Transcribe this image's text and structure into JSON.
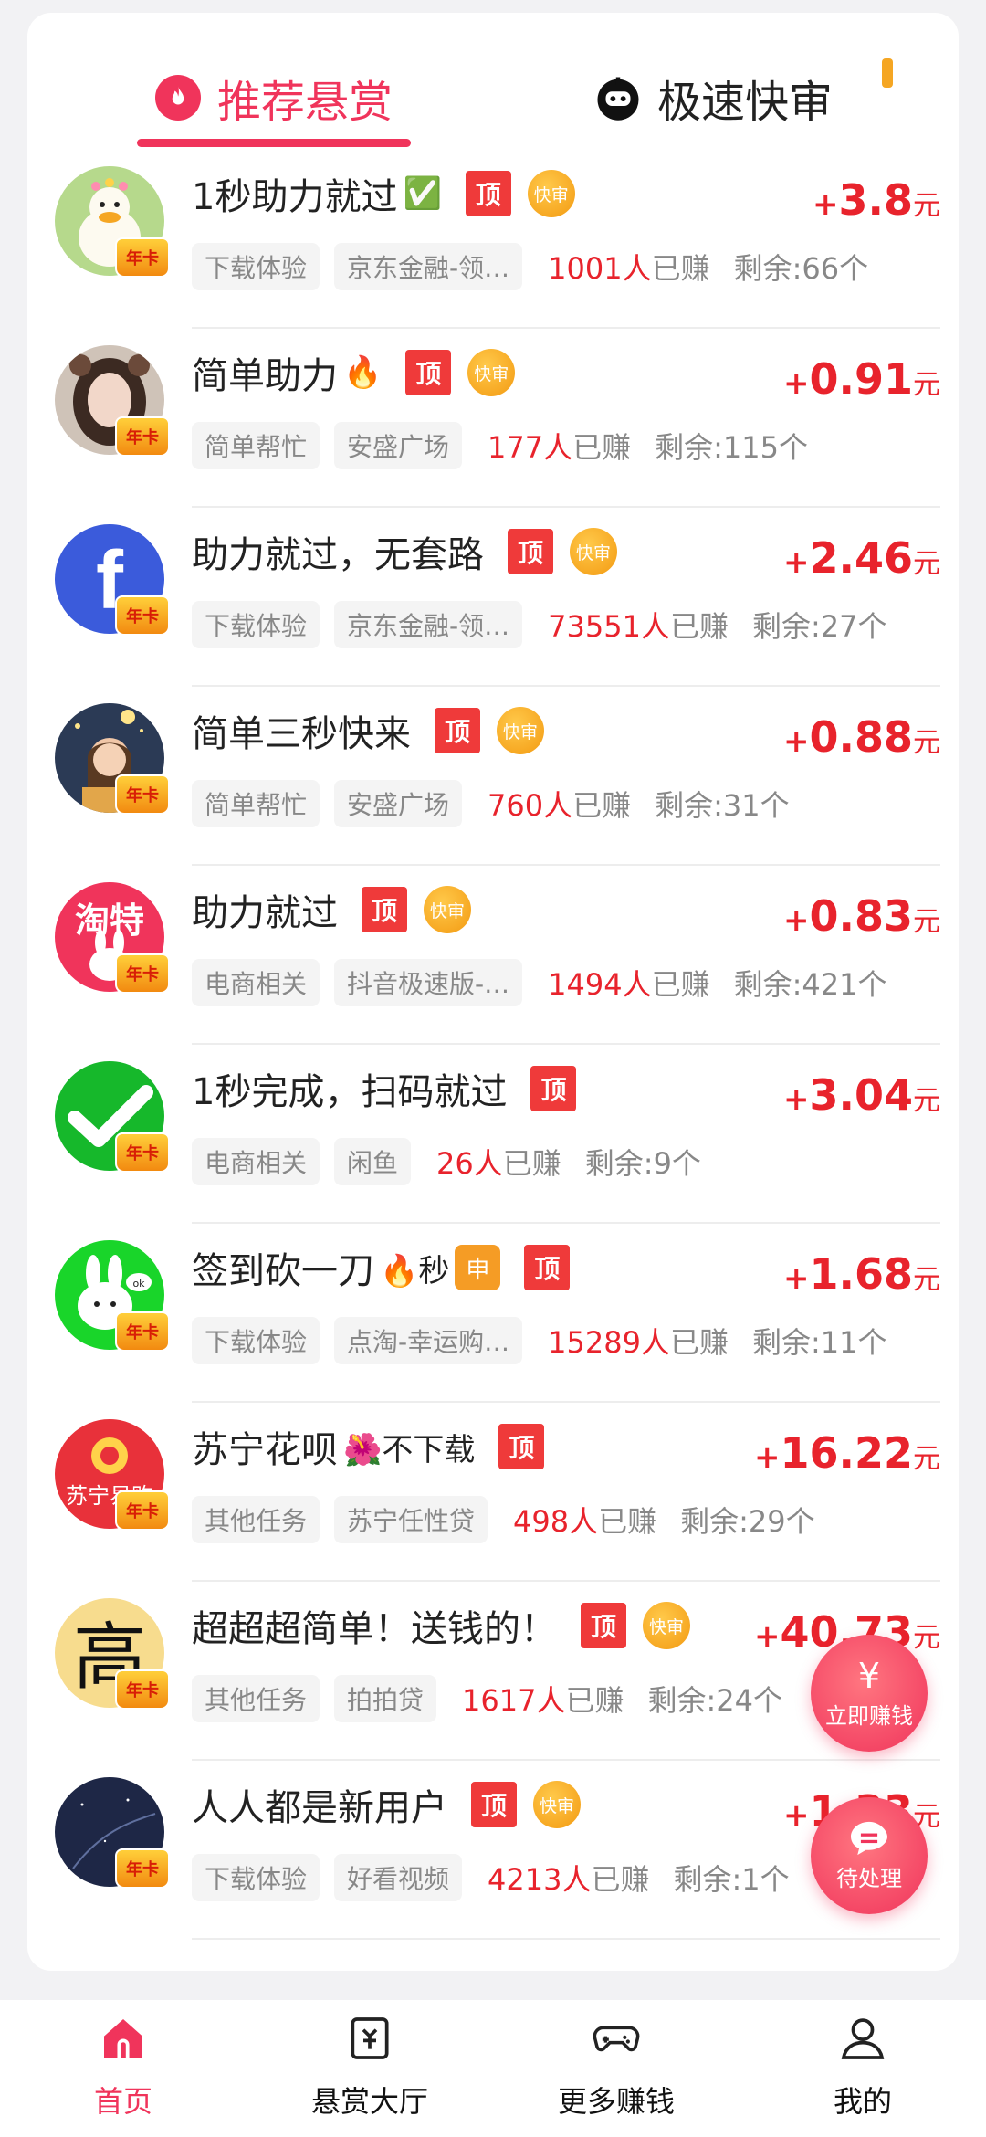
{
  "tabs": {
    "recommended": "推荐悬赏",
    "fast": "极速快审"
  },
  "badges": {
    "ding": "顶",
    "kuai": "快审",
    "year_card": "年卡",
    "shen": "申"
  },
  "tasks": [
    {
      "title": "1秒助力就过",
      "emoji": "✅",
      "ding": true,
      "kuai": true,
      "reward": "3.8",
      "cat": "下载体验",
      "app": "京东金融-领…",
      "earned": "1001人",
      "earned_suffix": "已赚",
      "remain": "剩余:66个",
      "avatar": "duck"
    },
    {
      "title": "简单助力",
      "emoji": "🔥",
      "ding": true,
      "kuai": true,
      "reward": "0.91",
      "cat": "简单帮忙",
      "app": "安盛广场",
      "earned": "177人",
      "earned_suffix": "已赚",
      "remain": "剩余:115个",
      "avatar": "girl"
    },
    {
      "title": "助力就过，无套路",
      "emoji": "",
      "ding": true,
      "kuai": true,
      "reward": "2.46",
      "cat": "下载体验",
      "app": "京东金融-领…",
      "earned": "73551人",
      "earned_suffix": "已赚",
      "remain": "剩余:27个",
      "avatar": "fb"
    },
    {
      "title": "简单三秒快来",
      "emoji": "",
      "ding": true,
      "kuai": true,
      "reward": "0.88",
      "cat": "简单帮忙",
      "app": "安盛广场",
      "earned": "760人",
      "earned_suffix": "已赚",
      "remain": "剩余:31个",
      "avatar": "night"
    },
    {
      "title": "助力就过",
      "emoji": "",
      "ding": true,
      "kuai": true,
      "reward": "0.83",
      "cat": "电商相关",
      "app": "抖音极速版-…",
      "earned": "1494人",
      "earned_suffix": "已赚",
      "remain": "剩余:421个",
      "avatar": "taote"
    },
    {
      "title": "1秒完成，扫码就过",
      "emoji": "",
      "ding": true,
      "kuai": false,
      "reward": "3.04",
      "cat": "电商相关",
      "app": "闲鱼",
      "earned": "26人",
      "earned_suffix": "已赚",
      "remain": "剩余:9个",
      "avatar": "check"
    },
    {
      "title": "签到砍一刀",
      "emoji": "🔥秒",
      "shen": true,
      "ding": true,
      "kuai": false,
      "reward": "1.68",
      "cat": "下载体验",
      "app": "点淘-幸运购…",
      "earned": "15289人",
      "earned_suffix": "已赚",
      "remain": "剩余:11个",
      "avatar": "bunny"
    },
    {
      "title": "苏宁花呗",
      "emoji": "🌺不下载",
      "ding": true,
      "kuai": false,
      "reward": "16.22",
      "cat": "其他任务",
      "app": "苏宁任性贷",
      "earned": "498人",
      "earned_suffix": "已赚",
      "remain": "剩余:29个",
      "avatar": "suning"
    },
    {
      "title": "超超超简单！送钱的！",
      "emoji": "",
      "ding": true,
      "kuai": true,
      "reward": "40.73",
      "cat": "其他任务",
      "app": "拍拍贷",
      "earned": "1617人",
      "earned_suffix": "已赚",
      "remain": "剩余:24个",
      "avatar": "gao"
    },
    {
      "title": "人人都是新用户",
      "emoji": "",
      "ding": true,
      "kuai": true,
      "reward": "1.33",
      "cat": "下载体验",
      "app": "好看视频",
      "earned": "4213人",
      "earned_suffix": "已赚",
      "remain": "剩余:1个",
      "avatar": "star"
    }
  ],
  "reward_prefix": "+",
  "reward_unit": "元",
  "fab": {
    "earn_label": "立即赚钱",
    "earn_icon": "¥",
    "todo_label": "待处理"
  },
  "nav": [
    {
      "label": "首页",
      "icon": "home-icon"
    },
    {
      "label": "悬赏大厅",
      "icon": "reward-hall-icon"
    },
    {
      "label": "更多赚钱",
      "icon": "gamepad-icon"
    },
    {
      "label": "我的",
      "icon": "user-icon"
    }
  ],
  "colors": {
    "accent": "#f0345b",
    "reward": "#e8232c",
    "ding": "#ef3a3a",
    "kuai": "#f39a12"
  }
}
